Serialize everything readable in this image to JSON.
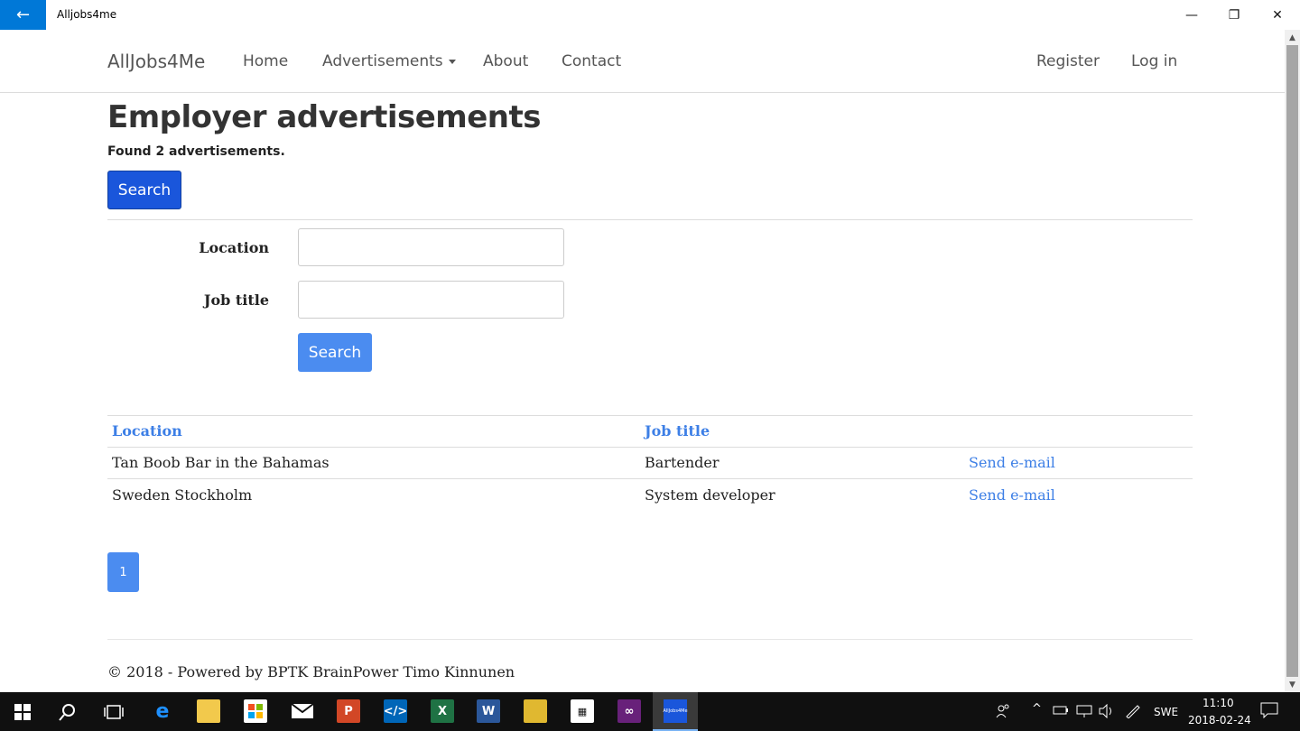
{
  "window": {
    "title": "Alljobs4me",
    "back_icon": "←",
    "min_icon": "—",
    "max_icon": "❐",
    "close_icon": "✕"
  },
  "navbar": {
    "brand": "AllJobs4Me",
    "items": [
      {
        "label": "Home"
      },
      {
        "label": "Advertisements"
      },
      {
        "label": "About"
      },
      {
        "label": "Contact"
      }
    ],
    "right": [
      {
        "label": "Register"
      },
      {
        "label": "Log in"
      }
    ]
  },
  "page": {
    "title": "Employer advertisements",
    "found": "Found 2 advertisements.",
    "search_toggle": "Search"
  },
  "form": {
    "location_label": "Location",
    "location_value": "",
    "job_title_label": "Job title",
    "job_title_value": "",
    "submit": "Search"
  },
  "table": {
    "headers": [
      "Location",
      "Job title"
    ],
    "rows": [
      {
        "location": "Tan Boob Bar in the Bahamas",
        "job_title": "Bartender",
        "action": "Send e-mail"
      },
      {
        "location": "Sweden Stockholm",
        "job_title": "System developer",
        "action": "Send e-mail"
      }
    ]
  },
  "pagination": {
    "current": "1"
  },
  "footer": {
    "text": "© 2018 - Powered by BPTK BrainPower Timo Kinnunen"
  },
  "taskbar": {
    "language": "SWE",
    "time": "11:10",
    "date": "2018-02-24",
    "active_app_label": "AllJobs4Me"
  },
  "colors": {
    "accent": "#0078d7",
    "primary_button": "#1a56db",
    "link": "#3d7fe6",
    "taskbar": "#101010"
  }
}
